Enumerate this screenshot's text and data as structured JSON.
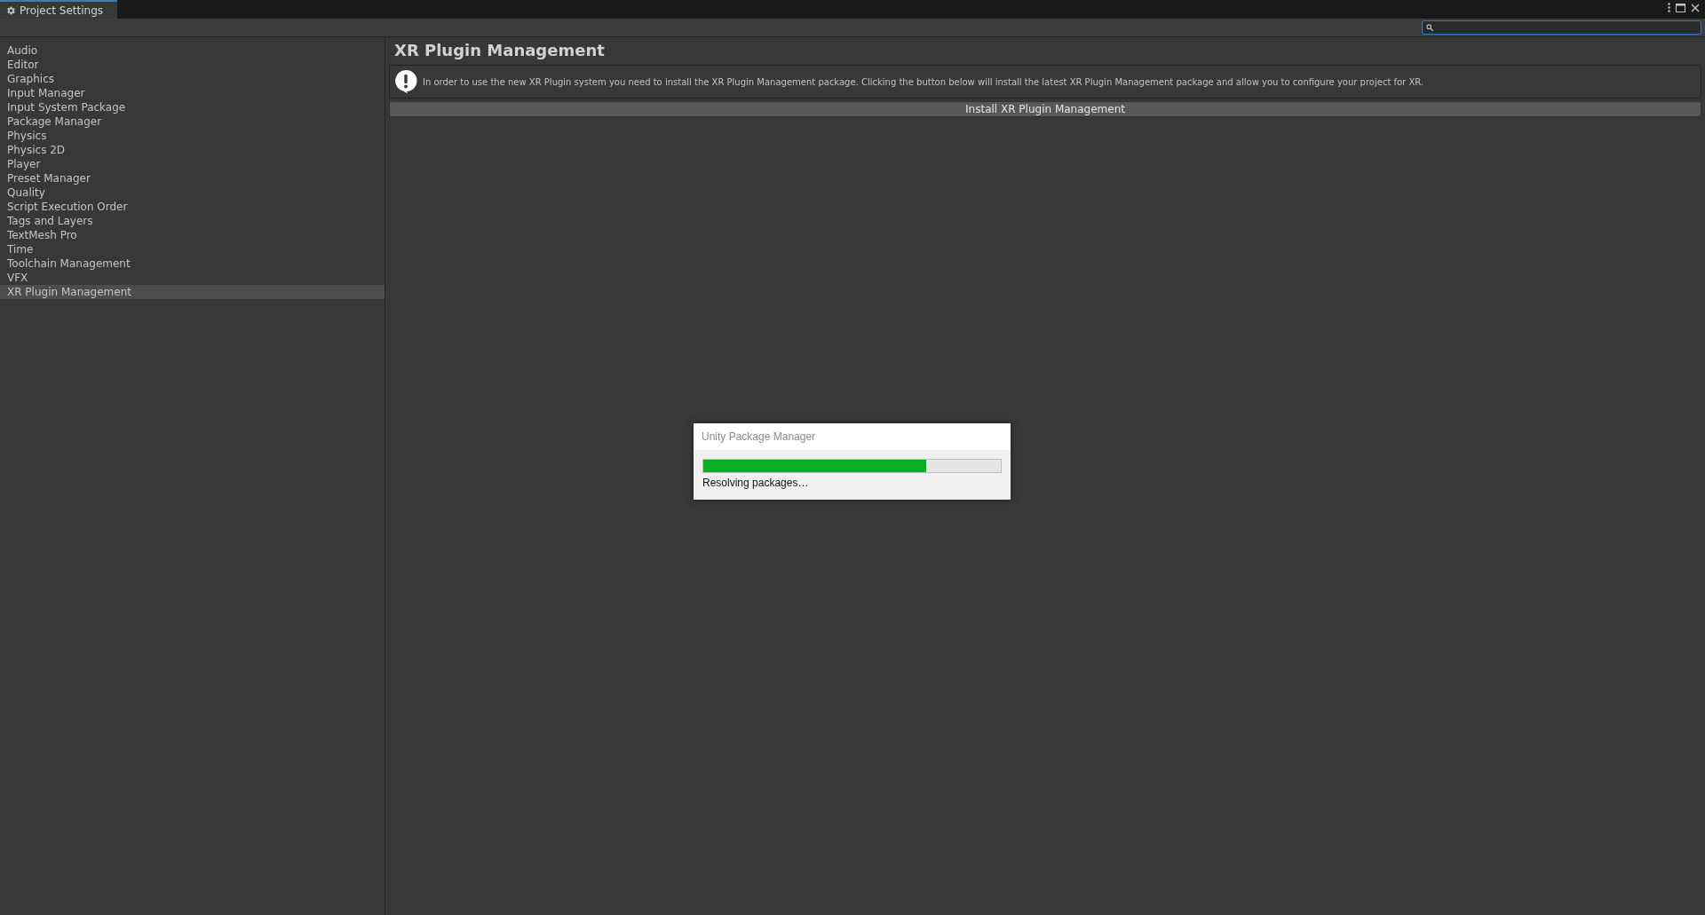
{
  "window": {
    "tab": "Project Settings"
  },
  "sidebar": {
    "items": [
      {
        "label": "Audio",
        "selected": false
      },
      {
        "label": "Editor",
        "selected": false
      },
      {
        "label": "Graphics",
        "selected": false
      },
      {
        "label": "Input Manager",
        "selected": false
      },
      {
        "label": "Input System Package",
        "selected": false
      },
      {
        "label": "Package Manager",
        "selected": false
      },
      {
        "label": "Physics",
        "selected": false
      },
      {
        "label": "Physics 2D",
        "selected": false
      },
      {
        "label": "Player",
        "selected": false
      },
      {
        "label": "Preset Manager",
        "selected": false
      },
      {
        "label": "Quality",
        "selected": false
      },
      {
        "label": "Script Execution Order",
        "selected": false
      },
      {
        "label": "Tags and Layers",
        "selected": false
      },
      {
        "label": "TextMesh Pro",
        "selected": false
      },
      {
        "label": "Time",
        "selected": false
      },
      {
        "label": "Toolchain Management",
        "selected": false
      },
      {
        "label": "VFX",
        "selected": false
      },
      {
        "label": "XR Plugin Management",
        "selected": true
      }
    ]
  },
  "content": {
    "title": "XR Plugin Management",
    "help_text": "In order to use the new XR Plugin system you need to install the XR Plugin Management package. Clicking the button below will install the latest XR Plugin Management package and allow you to configure your project for XR.",
    "button": "Install XR Plugin Management"
  },
  "dialog": {
    "title": "Unity Package Manager",
    "level": 0.75,
    "status": "Resolving packages…"
  }
}
